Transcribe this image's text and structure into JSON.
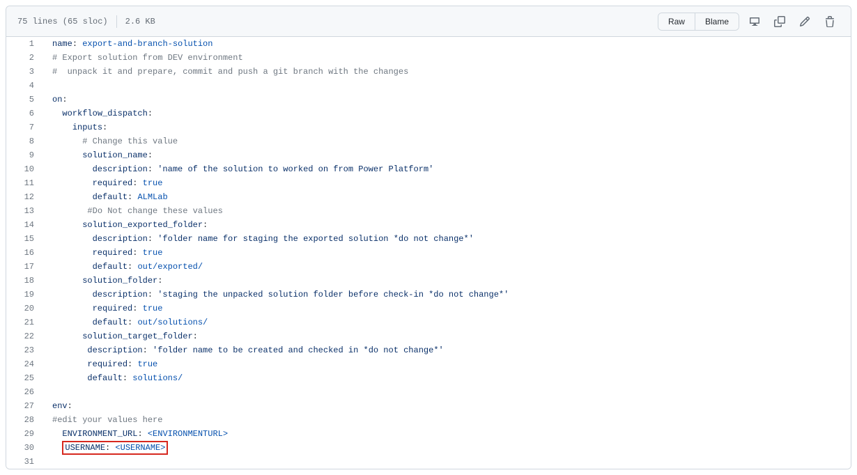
{
  "header": {
    "lines": "75 lines (65 sloc)",
    "size": "2.6 KB",
    "raw": "Raw",
    "blame": "Blame"
  },
  "code": [
    {
      "n": 1,
      "seg": [
        [
          "k",
          "name"
        ],
        [
          "p",
          ": "
        ],
        [
          "v",
          "export-and-branch-solution"
        ]
      ]
    },
    {
      "n": 2,
      "seg": [
        [
          "c",
          "# Export solution from DEV environment"
        ]
      ]
    },
    {
      "n": 3,
      "seg": [
        [
          "c",
          "#  unpack it and prepare, commit and push a git branch with the changes"
        ]
      ]
    },
    {
      "n": 4,
      "seg": []
    },
    {
      "n": 5,
      "seg": [
        [
          "k",
          "on"
        ],
        [
          "p",
          ":"
        ]
      ]
    },
    {
      "n": 6,
      "seg": [
        [
          "p",
          "  "
        ],
        [
          "k",
          "workflow_dispatch"
        ],
        [
          "p",
          ":"
        ]
      ]
    },
    {
      "n": 7,
      "seg": [
        [
          "p",
          "    "
        ],
        [
          "k",
          "inputs"
        ],
        [
          "p",
          ":"
        ]
      ]
    },
    {
      "n": 8,
      "seg": [
        [
          "p",
          "      "
        ],
        [
          "c",
          "# Change this value"
        ]
      ]
    },
    {
      "n": 9,
      "seg": [
        [
          "p",
          "      "
        ],
        [
          "k",
          "solution_name"
        ],
        [
          "p",
          ":"
        ]
      ]
    },
    {
      "n": 10,
      "seg": [
        [
          "p",
          "        "
        ],
        [
          "k",
          "description"
        ],
        [
          "p",
          ": "
        ],
        [
          "s",
          "'name of the solution to worked on from Power Platform'"
        ]
      ]
    },
    {
      "n": 11,
      "seg": [
        [
          "p",
          "        "
        ],
        [
          "k",
          "required"
        ],
        [
          "p",
          ": "
        ],
        [
          "v",
          "true"
        ]
      ]
    },
    {
      "n": 12,
      "seg": [
        [
          "p",
          "        "
        ],
        [
          "k",
          "default"
        ],
        [
          "p",
          ": "
        ],
        [
          "v",
          "ALMLab"
        ]
      ]
    },
    {
      "n": 13,
      "seg": [
        [
          "p",
          "       "
        ],
        [
          "c",
          "#Do Not change these values"
        ]
      ]
    },
    {
      "n": 14,
      "seg": [
        [
          "p",
          "      "
        ],
        [
          "k",
          "solution_exported_folder"
        ],
        [
          "p",
          ":"
        ]
      ]
    },
    {
      "n": 15,
      "seg": [
        [
          "p",
          "        "
        ],
        [
          "k",
          "description"
        ],
        [
          "p",
          ": "
        ],
        [
          "s",
          "'folder name for staging the exported solution *do not change*'"
        ]
      ]
    },
    {
      "n": 16,
      "seg": [
        [
          "p",
          "        "
        ],
        [
          "k",
          "required"
        ],
        [
          "p",
          ": "
        ],
        [
          "v",
          "true"
        ]
      ]
    },
    {
      "n": 17,
      "seg": [
        [
          "p",
          "        "
        ],
        [
          "k",
          "default"
        ],
        [
          "p",
          ": "
        ],
        [
          "v",
          "out/exported/"
        ]
      ]
    },
    {
      "n": 18,
      "seg": [
        [
          "p",
          "      "
        ],
        [
          "k",
          "solution_folder"
        ],
        [
          "p",
          ":"
        ]
      ]
    },
    {
      "n": 19,
      "seg": [
        [
          "p",
          "        "
        ],
        [
          "k",
          "description"
        ],
        [
          "p",
          ": "
        ],
        [
          "s",
          "'staging the unpacked solution folder before check-in *do not change*'"
        ]
      ]
    },
    {
      "n": 20,
      "seg": [
        [
          "p",
          "        "
        ],
        [
          "k",
          "required"
        ],
        [
          "p",
          ": "
        ],
        [
          "v",
          "true"
        ]
      ]
    },
    {
      "n": 21,
      "seg": [
        [
          "p",
          "        "
        ],
        [
          "k",
          "default"
        ],
        [
          "p",
          ": "
        ],
        [
          "v",
          "out/solutions/"
        ]
      ]
    },
    {
      "n": 22,
      "seg": [
        [
          "p",
          "      "
        ],
        [
          "k",
          "solution_target_folder"
        ],
        [
          "p",
          ":"
        ]
      ]
    },
    {
      "n": 23,
      "seg": [
        [
          "p",
          "       "
        ],
        [
          "k",
          "description"
        ],
        [
          "p",
          ": "
        ],
        [
          "s",
          "'folder name to be created and checked in *do not change*'"
        ]
      ]
    },
    {
      "n": 24,
      "seg": [
        [
          "p",
          "       "
        ],
        [
          "k",
          "required"
        ],
        [
          "p",
          ": "
        ],
        [
          "v",
          "true"
        ]
      ]
    },
    {
      "n": 25,
      "seg": [
        [
          "p",
          "       "
        ],
        [
          "k",
          "default"
        ],
        [
          "p",
          ": "
        ],
        [
          "v",
          "solutions/"
        ]
      ]
    },
    {
      "n": 26,
      "seg": []
    },
    {
      "n": 27,
      "seg": [
        [
          "k",
          "env"
        ],
        [
          "p",
          ":"
        ]
      ]
    },
    {
      "n": 28,
      "seg": [
        [
          "c",
          "#edit your values here"
        ]
      ]
    },
    {
      "n": 29,
      "seg": [
        [
          "p",
          "  "
        ],
        [
          "k",
          "ENVIRONMENT_URL"
        ],
        [
          "p",
          ": "
        ],
        [
          "v",
          "<ENVIRONMENTURL>"
        ]
      ]
    },
    {
      "n": 30,
      "hl": true,
      "seg": [
        [
          "p",
          "  "
        ],
        [
          "k",
          "USERNAME"
        ],
        [
          "p",
          ": "
        ],
        [
          "v",
          "<USERNAME>"
        ]
      ]
    },
    {
      "n": 31,
      "seg": []
    }
  ]
}
